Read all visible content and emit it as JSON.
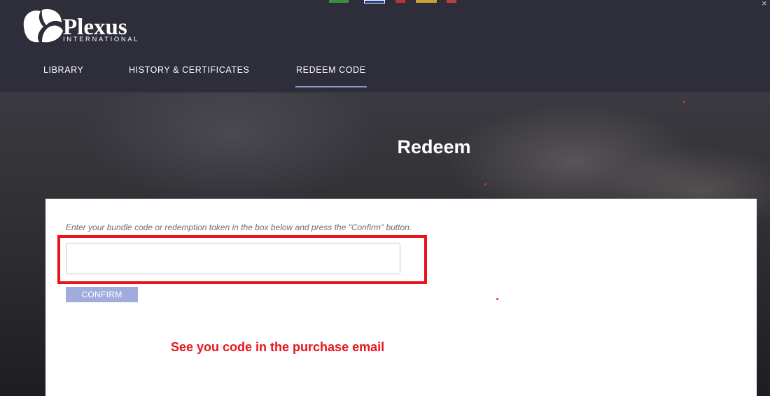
{
  "header": {
    "logo": {
      "wordmark": "Plexus",
      "subline": "INTERNATIONAL",
      "icon": "plexus-logo-icon"
    },
    "language_flags": [
      "flag-icon",
      "flag-icon",
      "flag-icon",
      "flag-icon",
      "flag-icon"
    ],
    "close_icon": "×",
    "nav": [
      {
        "label": "LIBRARY"
      },
      {
        "label": "HISTORY & CERTIFICATES"
      },
      {
        "label": "REDEEM CODE",
        "active": true
      }
    ]
  },
  "hero": {
    "title": "Redeem"
  },
  "card": {
    "instructions": "Enter your bundle code or redemption token in the box below and press the \"Confirm\" button.",
    "code_input": {
      "value": "",
      "placeholder": ""
    },
    "confirm_label": "CONFIRM"
  },
  "annotation": {
    "text": "See you code in the purchase email"
  },
  "colors": {
    "header_bg": "#2d2e39",
    "active_underline": "#8e9bc9",
    "confirm_button": "#a2acdc",
    "annotation_red": "#e8141c",
    "card_bg": "#ffffff"
  }
}
